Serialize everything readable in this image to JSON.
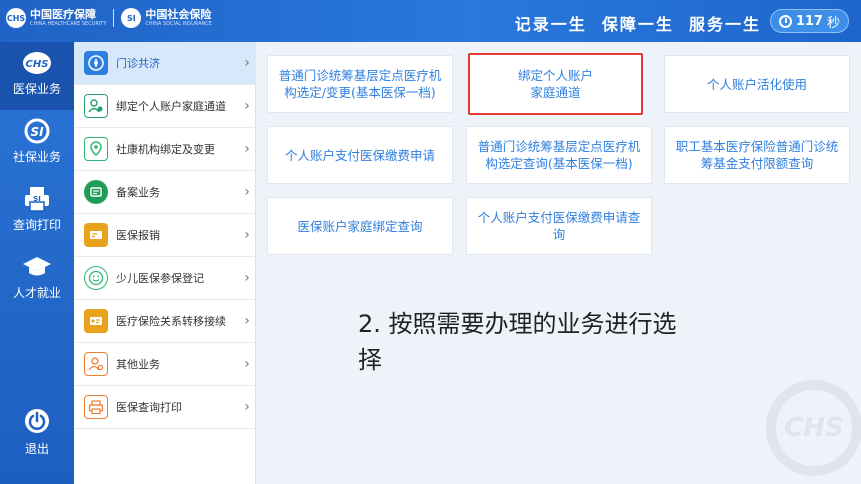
{
  "header": {
    "logo_badge_1": "CHS",
    "logo_name_1": "中国医疗保障",
    "logo_sub_1": "CHINA HEALTHCARE SECURITY",
    "logo_badge_2": "SI",
    "logo_name_2": "中国社会保险",
    "logo_sub_2": "CHINA SOCIAL INSURANCE",
    "slogan": "记录一生  保障一生  服务一生",
    "timer_value": "117",
    "timer_unit": "秒"
  },
  "rail": {
    "items": [
      {
        "label": "医保业务",
        "icon": "chs-icon"
      },
      {
        "label": "社保业务",
        "icon": "si-icon"
      },
      {
        "label": "查询打印",
        "icon": "printer-icon"
      },
      {
        "label": "人才就业",
        "icon": "graduation-cap-icon"
      }
    ],
    "exit_label": "退出"
  },
  "menu": {
    "items": [
      {
        "label": "门诊共济",
        "icon": "compass-icon",
        "color": "#2f7fe0"
      },
      {
        "label": "绑定个人账户家庭通道",
        "icon": "people-icon",
        "color": "#22a06b"
      },
      {
        "label": "社康机构绑定及变更",
        "icon": "location-icon",
        "color": "#2bb673"
      },
      {
        "label": "备案业务",
        "icon": "stamp-icon",
        "color": "#1f9d55"
      },
      {
        "label": "医保报销",
        "icon": "card-icon",
        "color": "#e8a21c"
      },
      {
        "label": "少儿医保参保登记",
        "icon": "smile-icon",
        "color": "#2bb673"
      },
      {
        "label": "医疗保险关系转移接续",
        "icon": "transfer-icon",
        "color": "#e8a21c"
      },
      {
        "label": "其他业务",
        "icon": "user-settings-icon",
        "color": "#ef7d32"
      },
      {
        "label": "医保查询打印",
        "icon": "printer-icon",
        "color": "#ef7d32"
      }
    ]
  },
  "tiles": [
    "普通门诊统筹基层定点医疗机构选定/变更(基本医保一档)",
    "绑定个人账户\n家庭通道",
    "个人账户活化使用",
    "个人账户支付医保缴费申请",
    "普通门诊统筹基层定点医疗机构选定查询(基本医保一档)",
    "职工基本医疗保险普通门诊统筹基金支付限额查询",
    "医保账户家庭绑定查询",
    "个人账户支付医保缴费申请查询"
  ],
  "instruction": "2. 按照需要办理的业务进行选择",
  "watermark": "CHS",
  "colors": {
    "header_blue": "#1f63c6",
    "tile_text": "#2f7fe0",
    "highlight_red": "#e53935"
  }
}
